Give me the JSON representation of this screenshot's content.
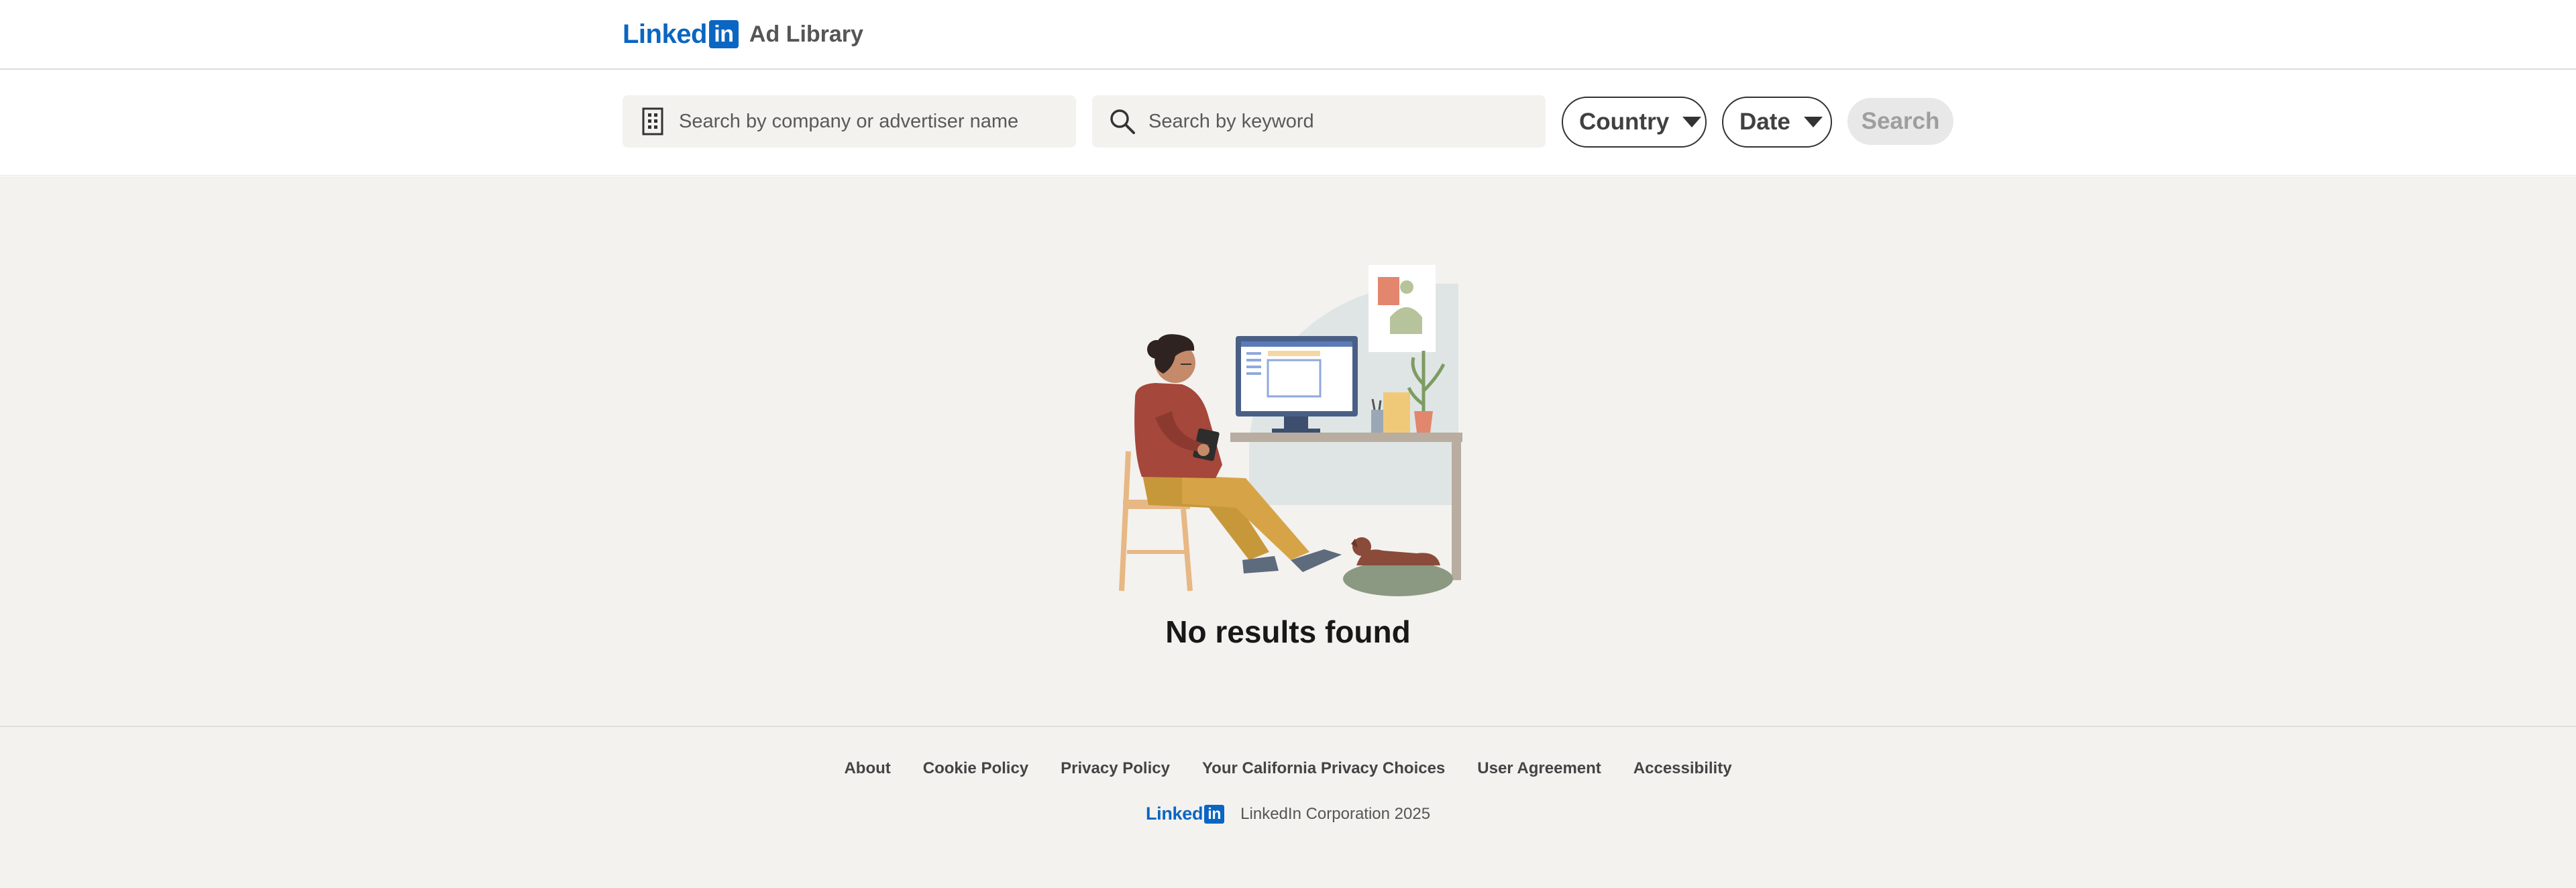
{
  "header": {
    "logo_text": "Linked",
    "logo_in": "in",
    "title": "Ad Library"
  },
  "search": {
    "company_placeholder": "Search by company or advertiser name",
    "company_icon": "building-icon",
    "keyword_placeholder": "Search by keyword",
    "keyword_icon": "search-icon",
    "country_label": "Country",
    "date_label": "Date",
    "search_label": "Search"
  },
  "main": {
    "empty_title": "No results found",
    "illustration": "person-at-desk-illustration"
  },
  "footer": {
    "links": [
      "About",
      "Cookie Policy",
      "Privacy Policy",
      "Your California Privacy Choices",
      "User Agreement",
      "Accessibility"
    ],
    "logo_text": "Linked",
    "logo_in": "in",
    "copyright": "LinkedIn Corporation 2025"
  },
  "colors": {
    "brand_blue": "#0a66c2",
    "page_bg": "#f3f2ef",
    "disabled_button": "#e8e8e8"
  }
}
